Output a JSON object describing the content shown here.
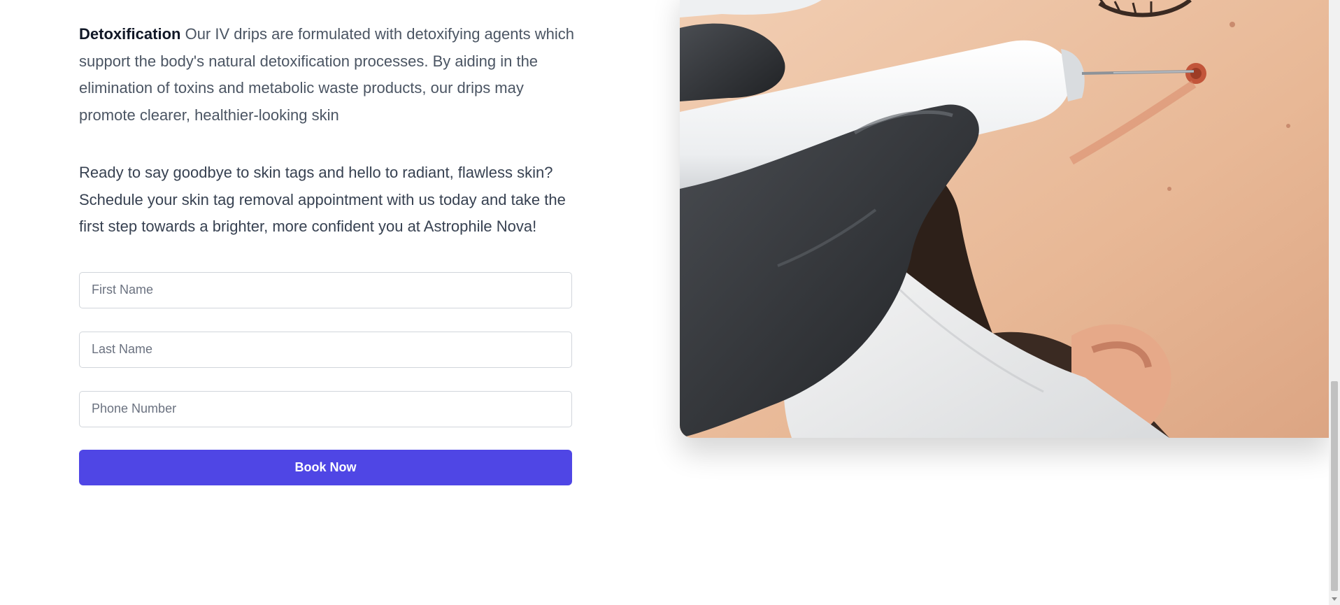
{
  "content": {
    "detox_title": "Detoxification",
    "detox_body": " Our IV drips are formulated with detoxifying agents which support the body's natural detoxification processes. By aiding in the elimination of toxins and metabolic waste products, our drips may promote clearer, healthier-looking skin",
    "cta_text": "Ready to say goodbye to skin tags and hello to radiant, flawless skin? Schedule your skin tag removal appointment with us today and take the first step towards a brighter, more confident you at Astrophile Nova!"
  },
  "form": {
    "first_name_placeholder": "First Name",
    "last_name_placeholder": "Last Name",
    "phone_placeholder": "Phone Number",
    "submit_label": "Book Now"
  },
  "colors": {
    "button": "#4f46e5",
    "body_text": "#4b5563"
  }
}
